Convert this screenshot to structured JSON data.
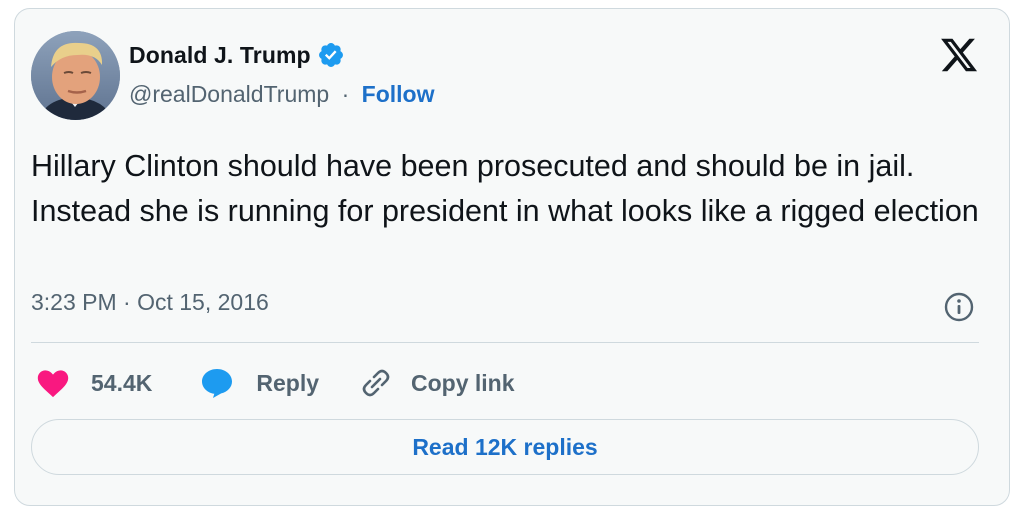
{
  "author": {
    "display_name": "Donald J. Trump",
    "handle": "@realDonaldTrump",
    "separator": "·",
    "follow_label": "Follow",
    "verified": true
  },
  "tweet": {
    "text": "Hillary Clinton should have been prosecuted and should be in jail. Instead she is running for president in what looks like a rigged election",
    "timestamp": "3:23 PM · Oct 15, 2016"
  },
  "actions": {
    "like_count": "54.4K",
    "reply_label": "Reply",
    "copy_link_label": "Copy link"
  },
  "read_replies_label": "Read 12K replies",
  "icons": {
    "brand": "x-logo-icon",
    "verified": "verified-badge-icon",
    "info": "info-icon",
    "like": "heart-icon",
    "reply": "speech-bubble-icon",
    "copy_link": "link-icon"
  },
  "colors": {
    "accent": "#1d70c9",
    "verified": "#1d9bf0",
    "like": "#f91880",
    "text": "#0f1419",
    "muted": "#536471",
    "background": "#f7f9f9",
    "border": "#cfd9de"
  }
}
